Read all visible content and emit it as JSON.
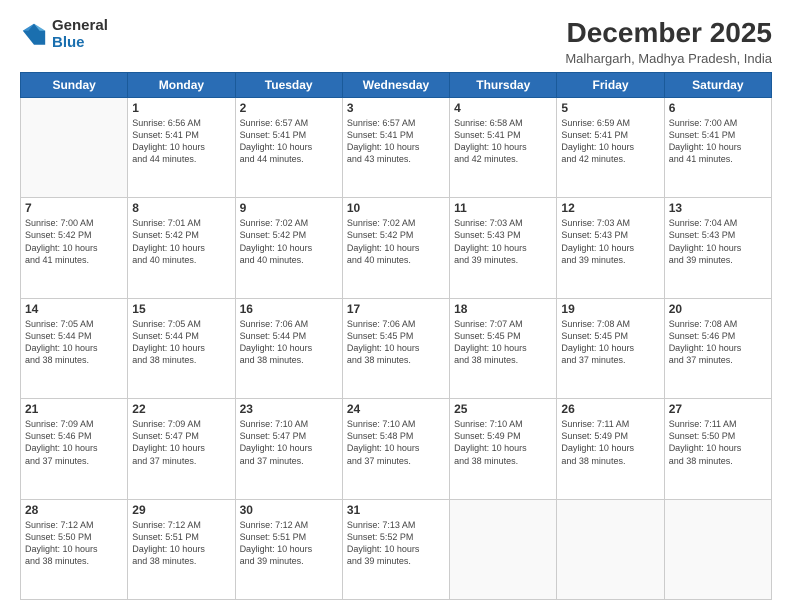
{
  "logo": {
    "general": "General",
    "blue": "Blue"
  },
  "title": "December 2025",
  "location": "Malhargarh, Madhya Pradesh, India",
  "days_of_week": [
    "Sunday",
    "Monday",
    "Tuesday",
    "Wednesday",
    "Thursday",
    "Friday",
    "Saturday"
  ],
  "weeks": [
    [
      {
        "day": "",
        "content": ""
      },
      {
        "day": "1",
        "content": "Sunrise: 6:56 AM\nSunset: 5:41 PM\nDaylight: 10 hours\nand 44 minutes."
      },
      {
        "day": "2",
        "content": "Sunrise: 6:57 AM\nSunset: 5:41 PM\nDaylight: 10 hours\nand 44 minutes."
      },
      {
        "day": "3",
        "content": "Sunrise: 6:57 AM\nSunset: 5:41 PM\nDaylight: 10 hours\nand 43 minutes."
      },
      {
        "day": "4",
        "content": "Sunrise: 6:58 AM\nSunset: 5:41 PM\nDaylight: 10 hours\nand 42 minutes."
      },
      {
        "day": "5",
        "content": "Sunrise: 6:59 AM\nSunset: 5:41 PM\nDaylight: 10 hours\nand 42 minutes."
      },
      {
        "day": "6",
        "content": "Sunrise: 7:00 AM\nSunset: 5:41 PM\nDaylight: 10 hours\nand 41 minutes."
      }
    ],
    [
      {
        "day": "7",
        "content": "Sunrise: 7:00 AM\nSunset: 5:42 PM\nDaylight: 10 hours\nand 41 minutes."
      },
      {
        "day": "8",
        "content": "Sunrise: 7:01 AM\nSunset: 5:42 PM\nDaylight: 10 hours\nand 40 minutes."
      },
      {
        "day": "9",
        "content": "Sunrise: 7:02 AM\nSunset: 5:42 PM\nDaylight: 10 hours\nand 40 minutes."
      },
      {
        "day": "10",
        "content": "Sunrise: 7:02 AM\nSunset: 5:42 PM\nDaylight: 10 hours\nand 40 minutes."
      },
      {
        "day": "11",
        "content": "Sunrise: 7:03 AM\nSunset: 5:43 PM\nDaylight: 10 hours\nand 39 minutes."
      },
      {
        "day": "12",
        "content": "Sunrise: 7:03 AM\nSunset: 5:43 PM\nDaylight: 10 hours\nand 39 minutes."
      },
      {
        "day": "13",
        "content": "Sunrise: 7:04 AM\nSunset: 5:43 PM\nDaylight: 10 hours\nand 39 minutes."
      }
    ],
    [
      {
        "day": "14",
        "content": "Sunrise: 7:05 AM\nSunset: 5:44 PM\nDaylight: 10 hours\nand 38 minutes."
      },
      {
        "day": "15",
        "content": "Sunrise: 7:05 AM\nSunset: 5:44 PM\nDaylight: 10 hours\nand 38 minutes."
      },
      {
        "day": "16",
        "content": "Sunrise: 7:06 AM\nSunset: 5:44 PM\nDaylight: 10 hours\nand 38 minutes."
      },
      {
        "day": "17",
        "content": "Sunrise: 7:06 AM\nSunset: 5:45 PM\nDaylight: 10 hours\nand 38 minutes."
      },
      {
        "day": "18",
        "content": "Sunrise: 7:07 AM\nSunset: 5:45 PM\nDaylight: 10 hours\nand 38 minutes."
      },
      {
        "day": "19",
        "content": "Sunrise: 7:08 AM\nSunset: 5:45 PM\nDaylight: 10 hours\nand 37 minutes."
      },
      {
        "day": "20",
        "content": "Sunrise: 7:08 AM\nSunset: 5:46 PM\nDaylight: 10 hours\nand 37 minutes."
      }
    ],
    [
      {
        "day": "21",
        "content": "Sunrise: 7:09 AM\nSunset: 5:46 PM\nDaylight: 10 hours\nand 37 minutes."
      },
      {
        "day": "22",
        "content": "Sunrise: 7:09 AM\nSunset: 5:47 PM\nDaylight: 10 hours\nand 37 minutes."
      },
      {
        "day": "23",
        "content": "Sunrise: 7:10 AM\nSunset: 5:47 PM\nDaylight: 10 hours\nand 37 minutes."
      },
      {
        "day": "24",
        "content": "Sunrise: 7:10 AM\nSunset: 5:48 PM\nDaylight: 10 hours\nand 37 minutes."
      },
      {
        "day": "25",
        "content": "Sunrise: 7:10 AM\nSunset: 5:49 PM\nDaylight: 10 hours\nand 38 minutes."
      },
      {
        "day": "26",
        "content": "Sunrise: 7:11 AM\nSunset: 5:49 PM\nDaylight: 10 hours\nand 38 minutes."
      },
      {
        "day": "27",
        "content": "Sunrise: 7:11 AM\nSunset: 5:50 PM\nDaylight: 10 hours\nand 38 minutes."
      }
    ],
    [
      {
        "day": "28",
        "content": "Sunrise: 7:12 AM\nSunset: 5:50 PM\nDaylight: 10 hours\nand 38 minutes."
      },
      {
        "day": "29",
        "content": "Sunrise: 7:12 AM\nSunset: 5:51 PM\nDaylight: 10 hours\nand 38 minutes."
      },
      {
        "day": "30",
        "content": "Sunrise: 7:12 AM\nSunset: 5:51 PM\nDaylight: 10 hours\nand 39 minutes."
      },
      {
        "day": "31",
        "content": "Sunrise: 7:13 AM\nSunset: 5:52 PM\nDaylight: 10 hours\nand 39 minutes."
      },
      {
        "day": "",
        "content": ""
      },
      {
        "day": "",
        "content": ""
      },
      {
        "day": "",
        "content": ""
      }
    ]
  ]
}
